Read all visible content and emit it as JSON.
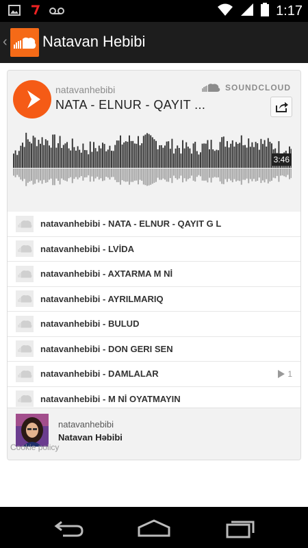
{
  "status_bar": {
    "time": "1:17",
    "icons": [
      "picture-icon",
      "notification-icon",
      "voicemail-icon",
      "wifi-icon",
      "signal-icon",
      "battery-icon"
    ]
  },
  "action_bar": {
    "title": "Natavan Hebibi"
  },
  "player": {
    "username": "natavanhebibi",
    "track_title": "NATA - ELNUR - QAYIT ...",
    "brand": "SOUNDCLOUD",
    "duration": "3:46"
  },
  "tracks": [
    {
      "label": "natavanhebibi - NATA - ELNUR - QAYIT G L",
      "plays": ""
    },
    {
      "label": "natavanhebibi -  LVİDA",
      "plays": ""
    },
    {
      "label": "natavanhebibi - AXTARMA M Nİ",
      "plays": ""
    },
    {
      "label": "natavanhebibi - AYRILMARIQ",
      "plays": ""
    },
    {
      "label": "natavanhebibi - BULUD",
      "plays": ""
    },
    {
      "label": "natavanhebibi - DON GERI SEN",
      "plays": ""
    },
    {
      "label": "natavanhebibi - DAMLALAR",
      "plays": "1"
    },
    {
      "label": "natavanhebibi - M Nİ OYATMAYIN",
      "plays": ""
    }
  ],
  "footer": {
    "username": "natavanhebibi",
    "display_name": "Natavan Həbibi",
    "cookie_link": "Cookie policy"
  },
  "colors": {
    "accent": "#f55b16",
    "action_bar": "#1d1d1d"
  }
}
